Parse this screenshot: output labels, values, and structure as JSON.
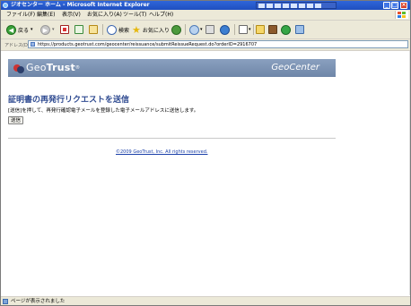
{
  "window": {
    "title": "ジオセンター ホーム - Microsoft Internet Explorer",
    "controls": {
      "minimize": "_",
      "maximize": "□",
      "close": "×"
    }
  },
  "menu": {
    "items": [
      {
        "label": "ファイル(F)"
      },
      {
        "label": "編集(E)"
      },
      {
        "label": "表示(V)"
      },
      {
        "label": "お気に入り(A)"
      },
      {
        "label": "ツール(T)"
      },
      {
        "label": "ヘルプ(H)"
      }
    ]
  },
  "toolbar": {
    "back_label": "戻る",
    "search_label": "検索",
    "favorites_label": "お気に入り"
  },
  "address": {
    "label": "アドレス(D)",
    "url": "https://products.geotrust.com/geocenter/reissuance/submitReissueRequest.do?orderID=2916707"
  },
  "header": {
    "brand_geo": "Geo",
    "brand_trust": "Trust",
    "brand_tm": "®",
    "product": "GeoCenter"
  },
  "main": {
    "title": "証明書の再発行リクエストを送信",
    "instruction": "[送信]を押して、再発行確認電子メールを登録した電子メールアドレスに送信します。",
    "send_button": "送信",
    "copyright": "©2009 GeoTrust, Inc. All rights reserved."
  },
  "status": {
    "text": "ページが表示されました"
  },
  "colors": {
    "titlebar": "#2f66d9",
    "header_band": "#7d93b4",
    "title_text": "#2f4b91",
    "link": "#1a3fa8"
  }
}
